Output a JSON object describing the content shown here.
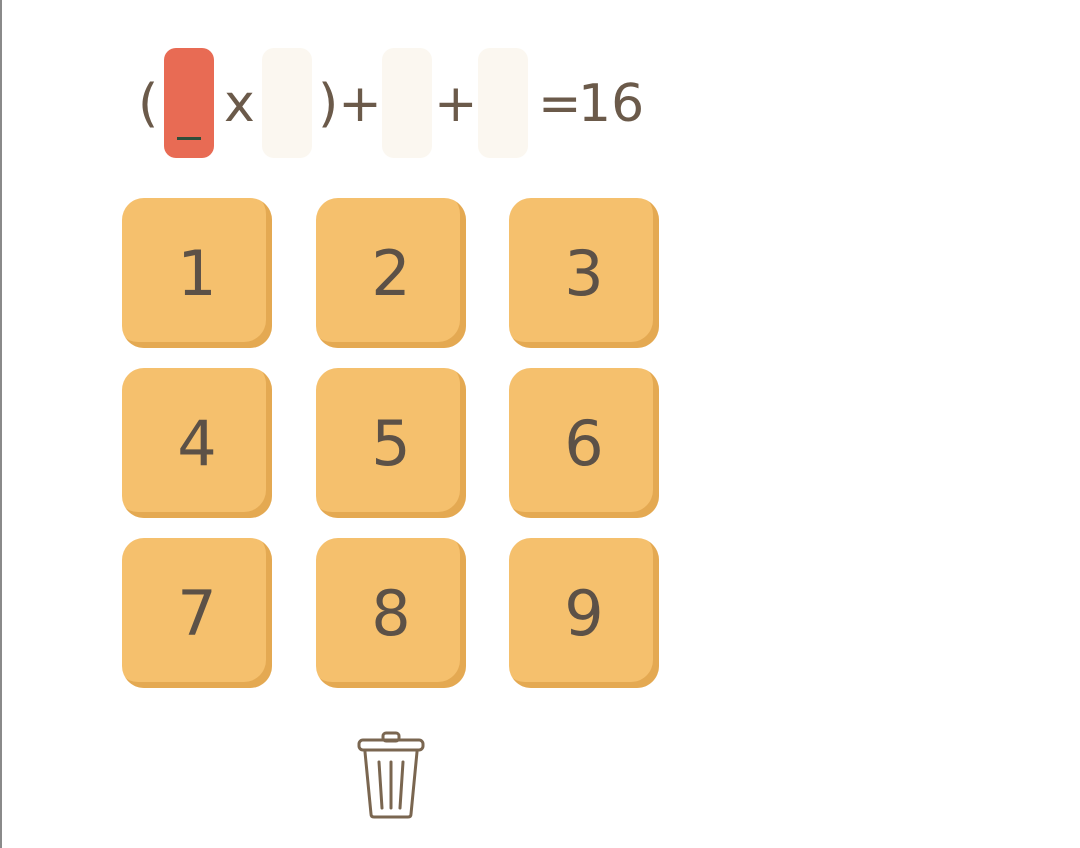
{
  "equation": {
    "open_paren": "(",
    "times": "x",
    "close_paren_plus": ")+",
    "plus": "+",
    "equals": "=",
    "target": "16"
  },
  "keypad": {
    "keys": [
      "1",
      "2",
      "3",
      "4",
      "5",
      "6",
      "7",
      "8",
      "9"
    ]
  },
  "icons": {
    "delete": "trash-icon"
  },
  "colors": {
    "key": "#f5c06d",
    "active_slot": "#e86b54",
    "text": "#6b5a4a"
  }
}
